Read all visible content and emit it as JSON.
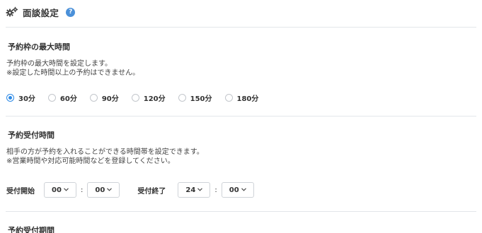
{
  "header": {
    "title": "面談設定",
    "help_label": "?"
  },
  "section_max_time": {
    "title": "予約枠の最大時間",
    "desc_line1": "予約枠の最大時間を設定します。",
    "desc_line2": "※設定した時間以上の予約はできません。",
    "options": [
      "30分",
      "60分",
      "90分",
      "120分",
      "150分",
      "180分"
    ],
    "selected": "30分"
  },
  "section_reception_time": {
    "title": "予約受付時間",
    "desc_line1": "相手の方が予約を入れることができる時間帯を設定できます。",
    "desc_line2": "※営業時間や対応可能時間などを登録してください。",
    "start_label": "受付開始",
    "start_hour": "00",
    "start_minute": "00",
    "end_label": "受付終了",
    "end_hour": "24",
    "end_minute": "00",
    "colon": ":"
  },
  "section_reception_period": {
    "title": "予約受付期間"
  },
  "colors": {
    "accent": "#2d8ae6",
    "help_icon": "#4a90d9",
    "divider": "#e3e6ea"
  }
}
